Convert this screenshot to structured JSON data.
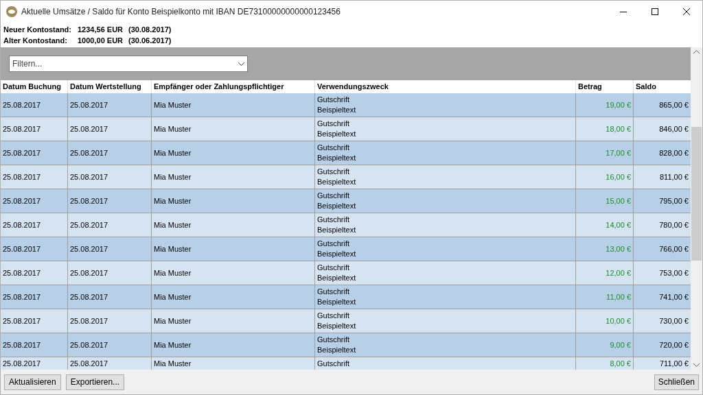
{
  "window": {
    "title": "Aktuelle Umsätze / Saldo für Konto Beispielkonto mit IBAN DE73100000000000123456"
  },
  "balances": [
    {
      "label": "Neuer Kontostand:",
      "amount": "1234,56 EUR",
      "date": "(30.08.2017)"
    },
    {
      "label": "Alter Kontostand:",
      "amount": "1000,00 EUR",
      "date": "(30.06.2017)"
    }
  ],
  "filter": {
    "placeholder": "Filtern..."
  },
  "table": {
    "columns": [
      "Datum Buchung",
      "Datum Wertstellung",
      "Empfänger oder Zahlungspflichtiger",
      "Verwendungszweck",
      "Betrag",
      "Saldo"
    ],
    "rows": [
      {
        "booking": "25.08.2017",
        "value_date": "25.08.2017",
        "party": "Mia Muster",
        "purpose": [
          "Gutschrift",
          "Beispieltext"
        ],
        "amount": "19,00 €",
        "balance": "865,00 €"
      },
      {
        "booking": "25.08.2017",
        "value_date": "25.08.2017",
        "party": "Mia Muster",
        "purpose": [
          "Gutschrift",
          "Beispieltext"
        ],
        "amount": "18,00 €",
        "balance": "846,00 €"
      },
      {
        "booking": "25.08.2017",
        "value_date": "25.08.2017",
        "party": "Mia Muster",
        "purpose": [
          "Gutschrift",
          "Beispieltext"
        ],
        "amount": "17,00 €",
        "balance": "828,00 €"
      },
      {
        "booking": "25.08.2017",
        "value_date": "25.08.2017",
        "party": "Mia Muster",
        "purpose": [
          "Gutschrift",
          "Beispieltext"
        ],
        "amount": "16,00 €",
        "balance": "811,00 €"
      },
      {
        "booking": "25.08.2017",
        "value_date": "25.08.2017",
        "party": "Mia Muster",
        "purpose": [
          "Gutschrift",
          "Beispieltext"
        ],
        "amount": "15,00 €",
        "balance": "795,00 €"
      },
      {
        "booking": "25.08.2017",
        "value_date": "25.08.2017",
        "party": "Mia Muster",
        "purpose": [
          "Gutschrift",
          "Beispieltext"
        ],
        "amount": "14,00 €",
        "balance": "780,00 €"
      },
      {
        "booking": "25.08.2017",
        "value_date": "25.08.2017",
        "party": "Mia Muster",
        "purpose": [
          "Gutschrift",
          "Beispieltext"
        ],
        "amount": "13,00 €",
        "balance": "766,00 €"
      },
      {
        "booking": "25.08.2017",
        "value_date": "25.08.2017",
        "party": "Mia Muster",
        "purpose": [
          "Gutschrift",
          "Beispieltext"
        ],
        "amount": "12,00 €",
        "balance": "753,00 €"
      },
      {
        "booking": "25.08.2017",
        "value_date": "25.08.2017",
        "party": "Mia Muster",
        "purpose": [
          "Gutschrift",
          "Beispieltext"
        ],
        "amount": "11,00 €",
        "balance": "741,00 €"
      },
      {
        "booking": "25.08.2017",
        "value_date": "25.08.2017",
        "party": "Mia Muster",
        "purpose": [
          "Gutschrift",
          "Beispieltext"
        ],
        "amount": "10,00 €",
        "balance": "730,00 €"
      },
      {
        "booking": "25.08.2017",
        "value_date": "25.08.2017",
        "party": "Mia Muster",
        "purpose": [
          "Gutschrift",
          "Beispieltext"
        ],
        "amount": "9,00 €",
        "balance": "720,00 €"
      },
      {
        "booking": "25.08.2017",
        "value_date": "25.08.2017",
        "party": "Mia Muster",
        "purpose": [
          "Gutschrift"
        ],
        "amount": "8,00 €",
        "balance": "711,00 €"
      }
    ]
  },
  "buttons_left": [
    "Aktualisieren",
    "Exportieren..."
  ],
  "buttons_right": [
    "Schließen"
  ]
}
